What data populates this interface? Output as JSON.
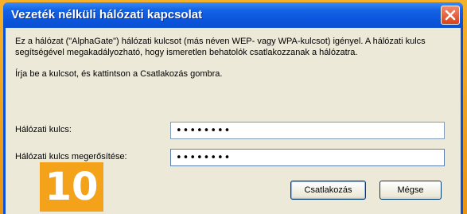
{
  "window": {
    "title": "Vezeték nélküli hálózati kapcsolat"
  },
  "dialog": {
    "description": "Ez a hálózat (\"AlphaGate\") hálózati kulcsot (más néven WEP- vagy WPA-kulcsot) igényel. A hálózati kulcs segítségével megakadályozható, hogy ismeretlen behatolók csatlakozzanak a hálózatra.",
    "prompt": "Írja be a kulcsot, és kattintson a Csatlakozás gombra.",
    "key_label": "Hálózati kulcs:",
    "key_value": "••••••••",
    "confirm_label": "Hálózati kulcs megerősítése:",
    "confirm_value": "••••••••",
    "connect_label": "Csatlakozás",
    "cancel_label": "Mégse"
  },
  "step": {
    "number": "10"
  },
  "icons": {
    "close": "close-icon"
  },
  "colors": {
    "titlebar": "#0a53d9",
    "client": "#ece9d8",
    "accent": "#f3a21a"
  }
}
